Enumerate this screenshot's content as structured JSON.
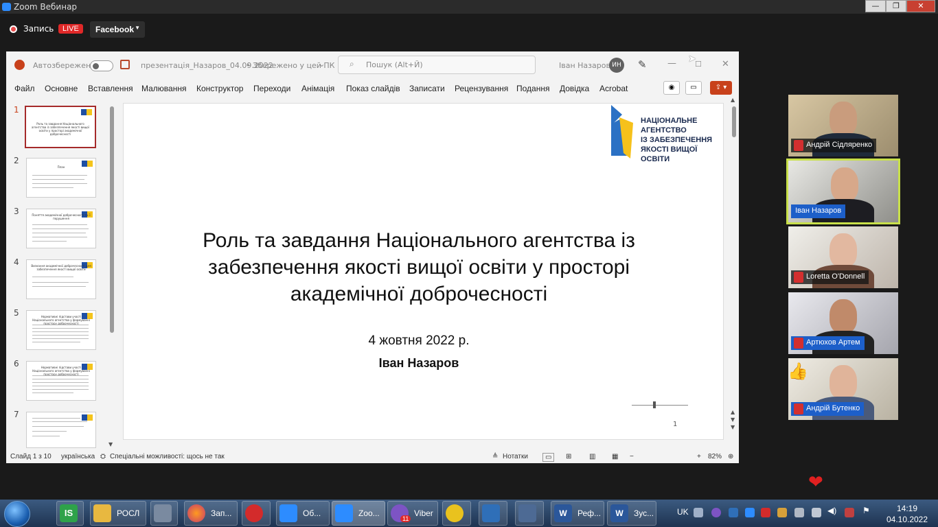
{
  "zoom": {
    "title": "Zoom Вебинар",
    "record_label": "Запись",
    "live_label": "LIVE",
    "stream_target": "Facebook",
    "window_controls": {
      "minimize": "—",
      "maximize": "❐",
      "close": "✕"
    }
  },
  "ppt": {
    "autosave_label": "Автозбереження",
    "file_name": "презентація_Назаров_04.09.2022",
    "save_status": "Збережено у цей ПК",
    "search_placeholder": "Пошук (Alt+Й)",
    "user_name": "Іван Назаров",
    "user_initials": "ИН",
    "menu": [
      "Файл",
      "Основне",
      "Вставлення",
      "Малювання",
      "Конструктор",
      "Переходи",
      "Анімація",
      "Показ слайдів",
      "Записати",
      "Рецензування",
      "Подання",
      "Довідка",
      "Acrobat"
    ],
    "thumb_numbers": [
      "1",
      "2",
      "3",
      "4",
      "5",
      "6",
      "7"
    ],
    "thumb_titles": [
      "Роль та завдання Національного агентства із забезпечення якості вищої освіти у просторі академічної доброчесності",
      "План",
      "Поняття академічної доброчесності та її порушення",
      "Визнання академічної доброчесності для забезпечення якості вищої освіти",
      "Нормативні підстави участі Національного агентства у формуванні простору доброчесності",
      "Нормативні підстави участі Національного агентства у формуванні простору доброчесності",
      ""
    ],
    "slide": {
      "title_lines": [
        "Роль та завдання Національного агентства із",
        "забезпечення якості вищої освіти у просторі",
        "академічної доброчесності"
      ],
      "date": "4 жовтня 2022 р.",
      "author": "Іван Назаров",
      "number": "1",
      "logo_lines": [
        "НАЦІОНАЛЬНЕ",
        "АГЕНТСТВО",
        "ІЗ ЗАБЕЗПЕЧЕННЯ",
        "ЯКОСТІ ВИЩОЇ ОСВІТИ"
      ]
    },
    "status": {
      "slide_count": "Слайд 1 з 10",
      "language": "українська",
      "accessibility": "Спеціальні можливості: щось не так",
      "notes": "Нотатки",
      "zoom_percent": "82%"
    }
  },
  "participants": [
    {
      "name": "Андрій Сідляренко",
      "muted": true,
      "active": false
    },
    {
      "name": "Іван Назаров",
      "muted": false,
      "active": true
    },
    {
      "name": "Loretta O'Donnell",
      "muted": true,
      "active": false
    },
    {
      "name": "Артюхов Артем",
      "muted": true,
      "active": false
    },
    {
      "name": "Андрій Бутенко",
      "muted": true,
      "active": false
    }
  ],
  "reactions": {
    "heart": "❤",
    "thumbs_up": "👍"
  },
  "taskbar": {
    "items": [
      "",
      "",
      "РОСЛ",
      "",
      "Зап...",
      "",
      "Об...",
      "Zoo...",
      "Viber",
      "",
      "",
      "",
      "Реф...",
      "Зус..."
    ],
    "viber_badge": "11",
    "lang": "UK",
    "time": "14:19",
    "date": "04.10.2022"
  },
  "colors": {
    "ppt_accent": "#c8411b",
    "zoom_blue": "#2d8cff",
    "active_speaker": "#c8e04a",
    "live_red": "#e02828"
  }
}
